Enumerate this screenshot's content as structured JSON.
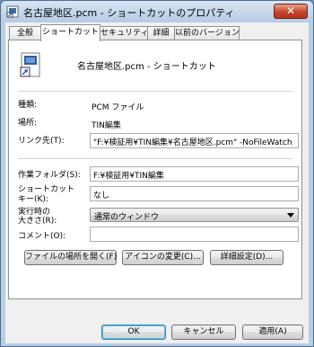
{
  "window": {
    "title": "名古屋地区.pcm - ショートカットのプロパティ",
    "close_glyph": "✕"
  },
  "tabs": [
    {
      "label": "全般"
    },
    {
      "label": "ショートカット"
    },
    {
      "label": "セキュリティ"
    },
    {
      "label": "詳細"
    },
    {
      "label": "以前のバージョン"
    }
  ],
  "active_tab": "ショートカット",
  "header": {
    "file_name": "名古屋地区.pcm - ショートカット",
    "icon": "shortcut-file-icon"
  },
  "fields": {
    "type_label": "種類:",
    "type_value": "PCM ファイル",
    "location_label": "場所:",
    "location_value": "TIN編集",
    "target_label": "リンク先(T):",
    "target_value": "\"F:¥検証用¥TIN編集¥名古屋地区.pcm\" -NoFileWatch",
    "start_in_label": "作業フォルダ(S):",
    "start_in_value": "F:¥検証用¥TIN編集",
    "shortcut_key_label_1": "ショートカット",
    "shortcut_key_label_2": "キー(K):",
    "shortcut_key_value": "なし",
    "run_label_1": "実行時の",
    "run_label_2": "大きさ(R):",
    "run_value": "通常のウィンドウ",
    "comment_label": "コメント(O):",
    "comment_value": ""
  },
  "buttons": {
    "open_location": "ファイルの場所を開く(F)",
    "change_icon": "アイコンの変更(C)...",
    "advanced": "詳細設定(D)...",
    "ok": "OK",
    "cancel": "キャンセル",
    "apply": "適用(A)"
  },
  "colors": {
    "frame": "#b9cde3",
    "close_button": "#c4452c",
    "panel": "#ffffff"
  }
}
